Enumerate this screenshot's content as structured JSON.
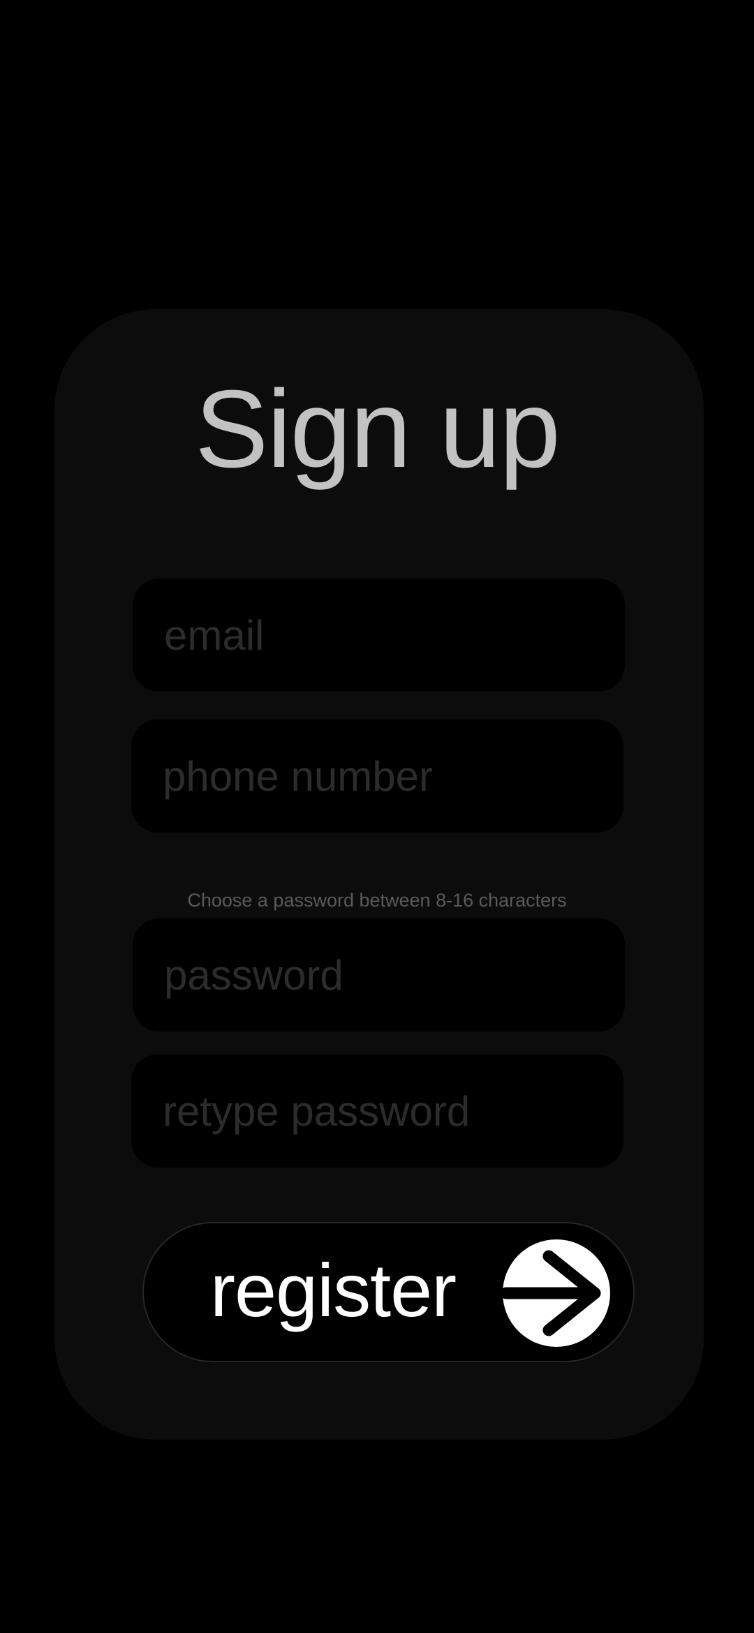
{
  "title": "Sign up",
  "fields": {
    "email": {
      "placeholder": "email",
      "value": ""
    },
    "phone": {
      "placeholder": "phone number",
      "value": ""
    },
    "password": {
      "placeholder": "password",
      "value": ""
    },
    "retype_password": {
      "placeholder": "retype password",
      "value": ""
    }
  },
  "password_hint": "Choose a password between 8-16 characters",
  "register": {
    "label": "register",
    "icon": "arrow-right-icon"
  },
  "colors": {
    "background": "#000000",
    "card": "#0c0c0c",
    "title": "#c2c2c2",
    "placeholder": "#2c2c2c",
    "hint": "#5a5a5a",
    "button_text": "#ffffff"
  }
}
